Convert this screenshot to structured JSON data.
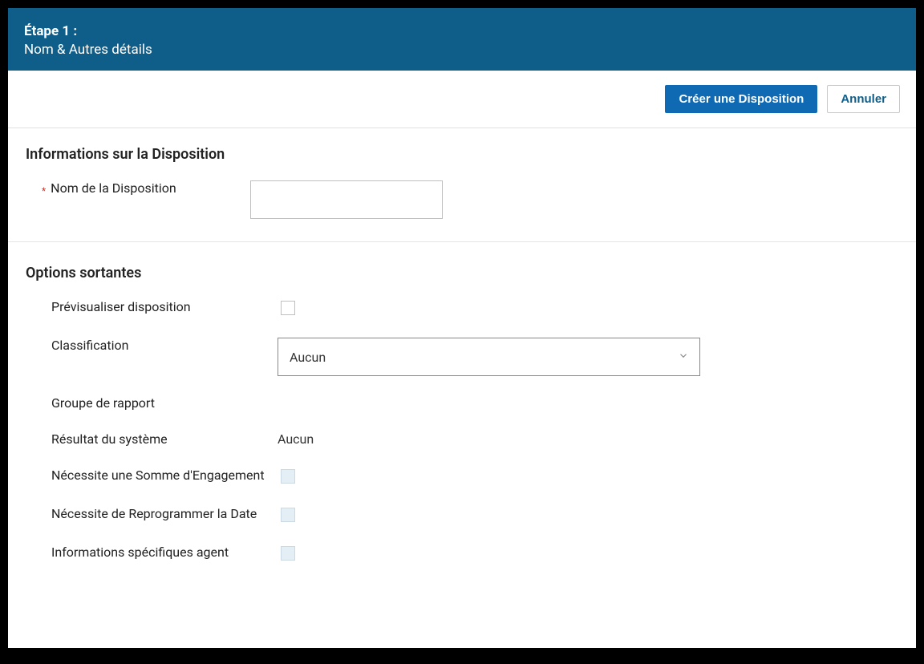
{
  "header": {
    "step": "Étape 1 :",
    "subtitle": "Nom & Autres détails"
  },
  "toolbar": {
    "create_label": "Créer une Disposition",
    "cancel_label": "Annuler"
  },
  "section1": {
    "title": "Informations sur la Disposition",
    "name_label": "Nom de la Disposition",
    "name_value": ""
  },
  "section2": {
    "title": "Options sortantes",
    "preview_label": "Prévisualiser disposition",
    "classification_label": "Classification",
    "classification_value": "Aucun",
    "report_group_label": "Groupe de rapport",
    "system_result_label": "Résultat du système",
    "system_result_value": "Aucun",
    "commitment_label": "Nécessite une Somme d'Engagement",
    "reschedule_label": "Nécessite de Reprogrammer la Date",
    "agent_info_label": "Informations spécifiques agent"
  }
}
